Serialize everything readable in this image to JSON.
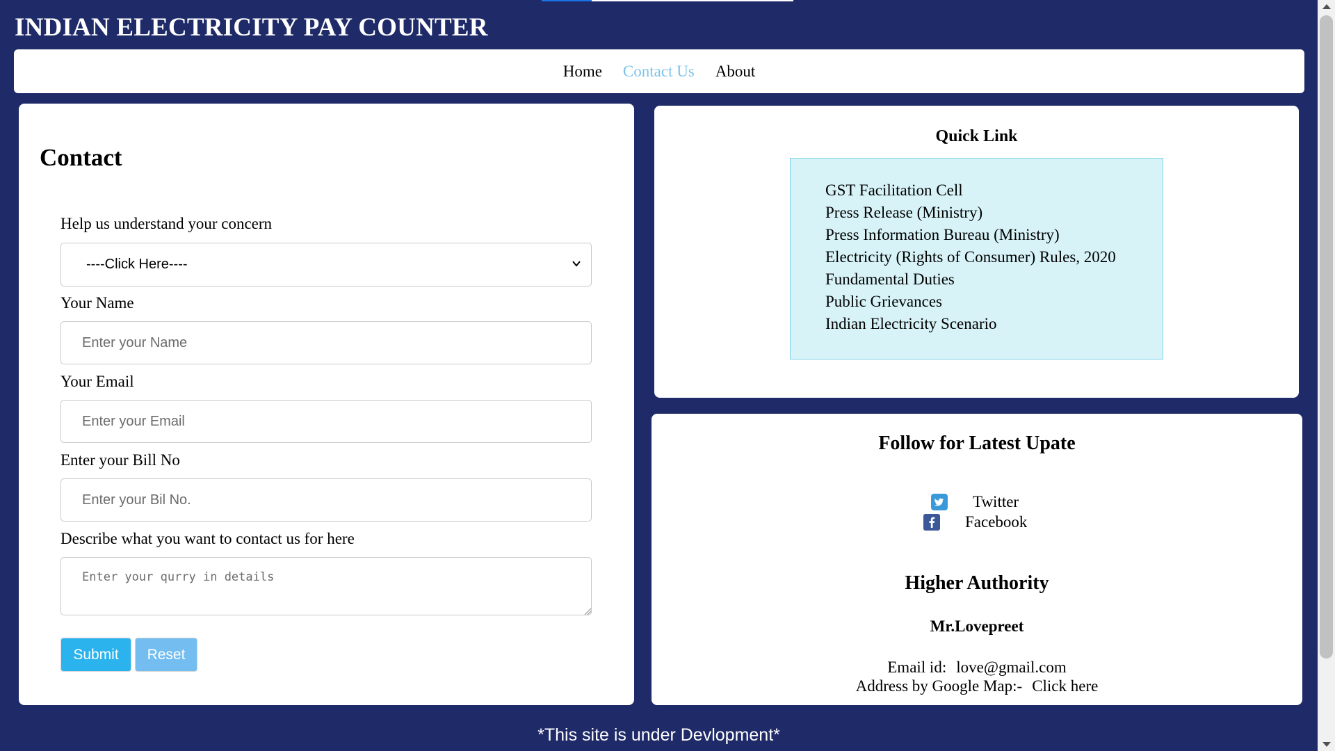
{
  "header": {
    "title": "INDIAN ELECTRICITY PAY COUNTER"
  },
  "nav": {
    "items": [
      {
        "label": "Home"
      },
      {
        "label": "Contact Us"
      },
      {
        "label": "About"
      }
    ],
    "active_color": "#7cc3ea"
  },
  "contact": {
    "heading": "Contact",
    "concern_label": "Help us understand your concern",
    "concern_selected": "----Click Here----",
    "name_label": "Your Name",
    "name_placeholder": "Enter your Name",
    "email_label": "Your Email",
    "email_placeholder": "Enter your Email",
    "bill_label": "Enter your Bill No",
    "bill_placeholder": "Enter your Bil No.",
    "describe_label": "Describe what you want to contact us for here",
    "describe_placeholder": "Enter your qurry in details",
    "submit_label": "Submit",
    "reset_label": "Reset"
  },
  "quick_link": {
    "heading": "Quick Link",
    "items": [
      "GST Facilitation Cell",
      "Press Release (Ministry)",
      "Press Information Bureau (Ministry)",
      "Electricity (Rights of Consumer) Rules, 2020",
      "Fundamental Duties",
      "Public Grievances",
      "Indian Electricity Scenario"
    ]
  },
  "follow": {
    "heading": "Follow for Latest Upate",
    "twitter_label": "Twitter",
    "twitter_icon": "twitter-icon",
    "facebook_label": "Facebook",
    "facebook_icon": "facebook-icon"
  },
  "authority": {
    "heading": "Higher Authority",
    "name": "Mr.Lovepreet",
    "email_label": "Email id:",
    "email_value": "love@gmail.com",
    "address_label": "Address by Google Map:-",
    "address_link": "Click here"
  },
  "footer": {
    "note": "*This site is under Devlopment*"
  },
  "colors": {
    "background": "#1f2a68",
    "submit_button": "#2ab3ec",
    "reset_button": "#73bdf1",
    "quick_box": "#d7f3f7"
  }
}
